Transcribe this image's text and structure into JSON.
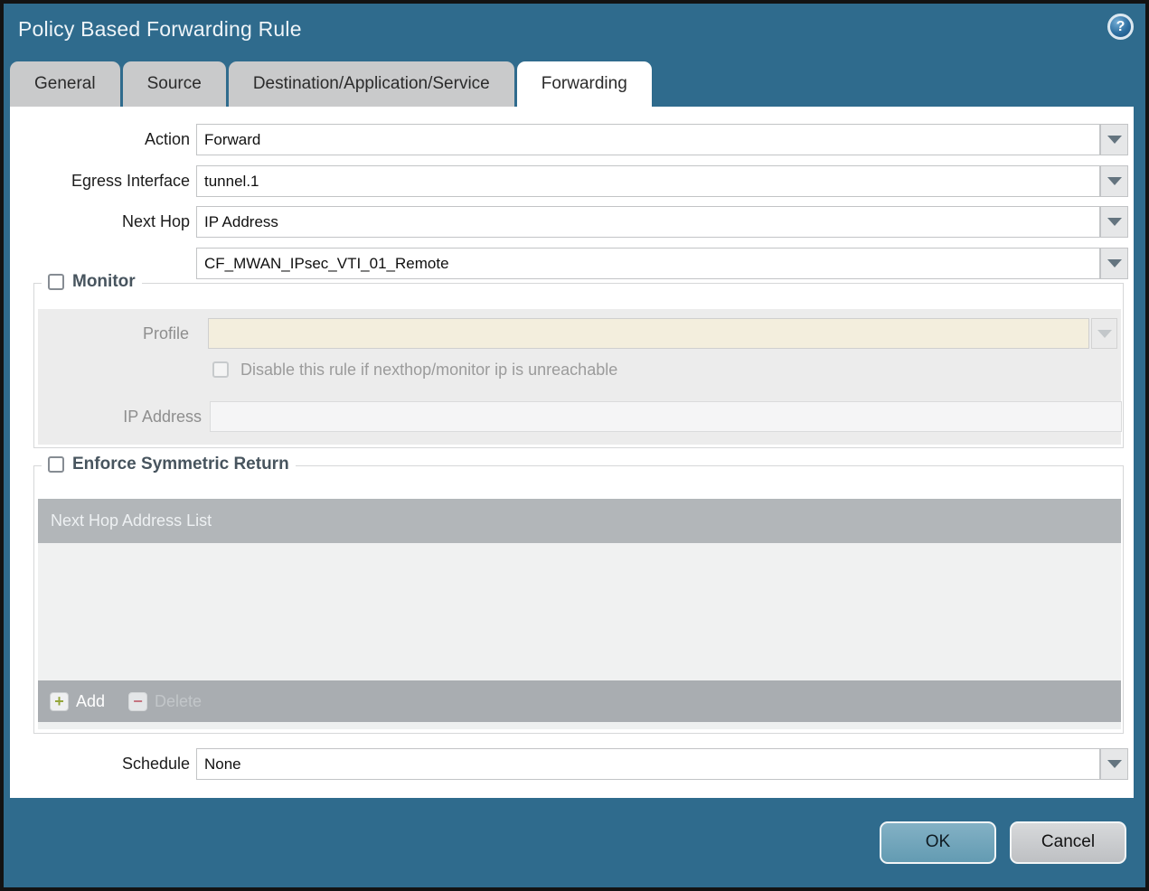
{
  "window": {
    "title": "Policy Based Forwarding Rule"
  },
  "icons": {
    "help_glyph": "?",
    "add_glyph": "+",
    "delete_glyph": "−"
  },
  "tabs": [
    {
      "label": "General",
      "active": false
    },
    {
      "label": "Source",
      "active": false
    },
    {
      "label": "Destination/Application/Service",
      "active": false
    },
    {
      "label": "Forwarding",
      "active": true
    }
  ],
  "form": {
    "action": {
      "label": "Action",
      "value": "Forward"
    },
    "egress_interface": {
      "label": "Egress Interface",
      "value": "tunnel.1"
    },
    "next_hop": {
      "label": "Next Hop",
      "value": "IP Address"
    },
    "next_hop_address": {
      "value": "CF_MWAN_IPsec_VTI_01_Remote"
    },
    "schedule": {
      "label": "Schedule",
      "value": "None"
    }
  },
  "monitor": {
    "label": "Monitor",
    "checked": false,
    "profile": {
      "label": "Profile",
      "value": "",
      "disabled": true
    },
    "disable_rule": {
      "label": "Disable this rule if nexthop/monitor ip is unreachable",
      "checked": false,
      "disabled": true
    },
    "ip_address": {
      "label": "IP Address",
      "value": "",
      "disabled": true
    }
  },
  "enforce_symmetric_return": {
    "label": "Enforce Symmetric Return",
    "checked": false,
    "table": {
      "header": "Next Hop Address List",
      "rows": []
    },
    "toolbar": {
      "add_label": "Add",
      "delete_label": "Delete",
      "delete_disabled": true
    }
  },
  "footer": {
    "ok_label": "OK",
    "cancel_label": "Cancel"
  },
  "colors": {
    "titlebar": "#2f6b8d",
    "tab_inactive": "#c9cacb",
    "monitor_panel": "#ececec",
    "profile_field": "#f3eedd",
    "table_header": "#b2b6b9",
    "table_footer": "#a9adb1",
    "ok_button": "#6fa2b9",
    "cancel_button": "#c7c9cc",
    "add_icon_green": "#95a63b",
    "delete_icon_red": "#c4737f"
  }
}
